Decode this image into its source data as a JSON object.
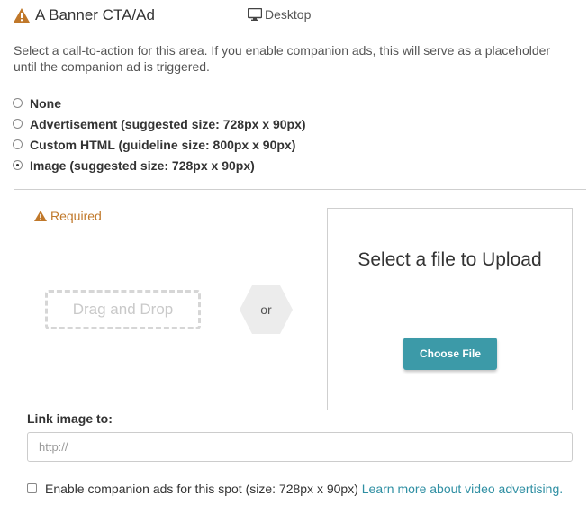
{
  "header": {
    "title": "A Banner CTA/Ad",
    "warning_icon": "warning-triangle-icon",
    "device_icon": "desktop-monitor-icon",
    "device_label": "Desktop"
  },
  "description": "Select a call-to-action for this area. If you enable companion ads, this will serve as a placeholder until the companion ad is triggered.",
  "cta_options": [
    {
      "label": "None",
      "selected": false
    },
    {
      "label": "Advertisement (suggested size: 728px x 90px)",
      "selected": false
    },
    {
      "label": "Custom HTML (guideline size: 800px x 90px)",
      "selected": false
    },
    {
      "label": "Image (suggested size: 728px x 90px)",
      "selected": true
    }
  ],
  "image_upload": {
    "required_label": "Required",
    "drag_drop_label": "Drag and Drop",
    "or_label": "or",
    "select_file_title": "Select a file to Upload",
    "choose_file_button": "Choose File"
  },
  "link": {
    "label": "Link image to:",
    "value": "",
    "placeholder": "http://"
  },
  "companion": {
    "checked": false,
    "text": "Enable companion ads for this spot (size: 728px x 90px)",
    "link_text": "Learn more about video advertising."
  },
  "colors": {
    "warning": "#c0782a",
    "button": "#3c9aa8",
    "link": "#2f8fa3"
  }
}
